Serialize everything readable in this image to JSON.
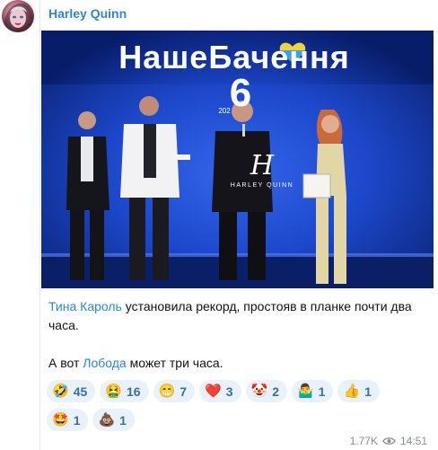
{
  "message": {
    "sender": "Harley Quinn",
    "paragraph1_mention": "Тина Кароль",
    "paragraph1_rest": " установила рекорд, простояв в планке почти два часа.",
    "paragraph2_start": "А вот ",
    "paragraph2_mention": "Лобода",
    "paragraph2_end": " может три часа.",
    "views": "1.77K",
    "time": "14:51"
  },
  "photo": {
    "show_title": "НашеБачення",
    "number": "6",
    "year_partial": "202",
    "watermark_letter": "H",
    "watermark_text": "HARLEY QUINN"
  },
  "reactions": [
    {
      "emoji": "🤣",
      "count": "45"
    },
    {
      "emoji": "🤮",
      "count": "16"
    },
    {
      "emoji": "😁",
      "count": "7"
    },
    {
      "emoji": "❤️",
      "count": "3"
    },
    {
      "emoji": "🤡",
      "count": "2"
    },
    {
      "emoji": "🤷‍♂️",
      "count": "1"
    },
    {
      "emoji": "👍",
      "count": "1"
    },
    {
      "emoji": "🤩",
      "count": "1"
    },
    {
      "emoji": "💩",
      "count": "1"
    }
  ],
  "colors": {
    "accent": "#2f86c9",
    "reaction_bg": "#e9f2fb",
    "stage_blue": "#0c2d8c"
  }
}
